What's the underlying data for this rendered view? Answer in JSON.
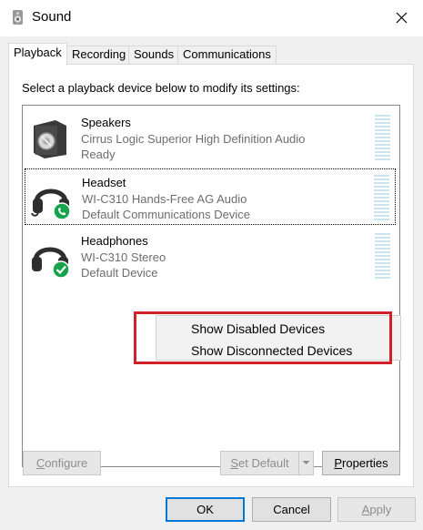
{
  "window": {
    "title": "Sound",
    "icon": "speaker-icon"
  },
  "tabs": [
    {
      "label": "Playback",
      "active": true
    },
    {
      "label": "Recording",
      "active": false
    },
    {
      "label": "Sounds",
      "active": false
    },
    {
      "label": "Communications",
      "active": false
    }
  ],
  "instruction": "Select a playback device below to modify its settings:",
  "devices": [
    {
      "name": "Speakers",
      "description": "Cirrus Logic Superior High Definition Audio",
      "status": "Ready",
      "icon": "speaker-device-icon"
    },
    {
      "name": "Headset",
      "description": "WI-C310 Hands-Free AG Audio",
      "status": "Default Communications Device",
      "icon": "headset-phone-icon",
      "badge": "phone-badge-icon"
    },
    {
      "name": "Headphones",
      "description": "WI-C310 Stereo",
      "status": "Default Device",
      "icon": "headphones-check-icon",
      "badge": "check-badge-icon"
    }
  ],
  "context_menu": {
    "items": [
      "Show Disabled Devices",
      "Show Disconnected Devices"
    ],
    "highlight_color": "#d0202a"
  },
  "buttons": {
    "configure": {
      "underline": "C",
      "rest": "onfigure"
    },
    "set_default": {
      "underline": "S",
      "rest": "et Default"
    },
    "properties": {
      "underline": "P",
      "rest": "roperties"
    },
    "ok": "OK",
    "cancel": "Cancel",
    "apply": {
      "underline": "A",
      "rest": "pply"
    }
  },
  "colors": {
    "accent": "#0078d7",
    "badge_green": "#17a34a",
    "meter": "#c9e3ef"
  }
}
